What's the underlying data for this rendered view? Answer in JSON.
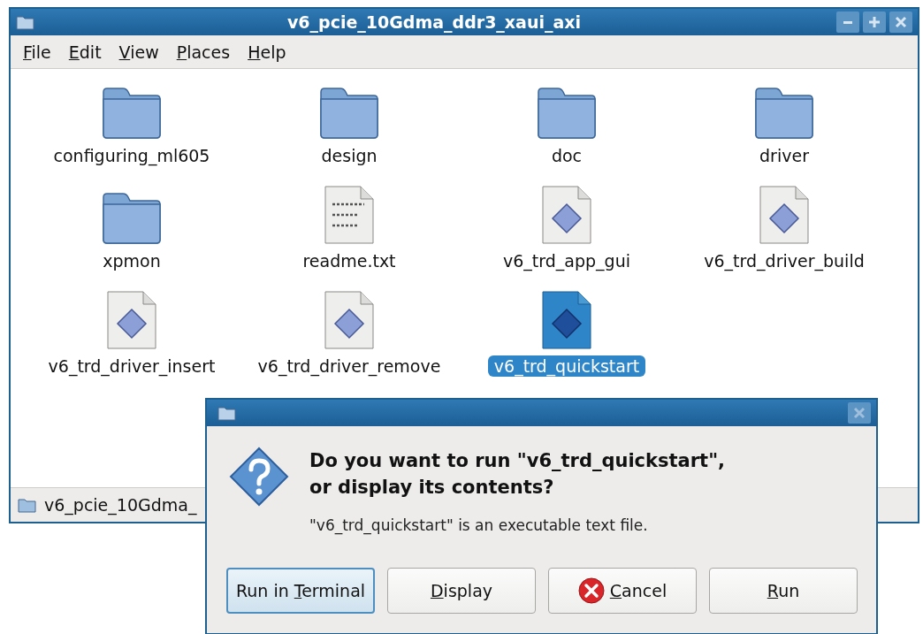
{
  "window": {
    "title": "v6_pcie_10Gdma_ddr3_xaui_axi"
  },
  "menu": [
    {
      "key": "F",
      "rest": "ile"
    },
    {
      "key": "E",
      "rest": "dit"
    },
    {
      "key": "V",
      "rest": "iew"
    },
    {
      "key": "P",
      "rest": "laces"
    },
    {
      "key": "H",
      "rest": "elp"
    }
  ],
  "files": [
    {
      "name": "configuring_ml605",
      "kind": "folder",
      "selected": false
    },
    {
      "name": "design",
      "kind": "folder",
      "selected": false
    },
    {
      "name": "doc",
      "kind": "folder",
      "selected": false
    },
    {
      "name": "driver",
      "kind": "folder",
      "selected": false
    },
    {
      "name": "xpmon",
      "kind": "folder",
      "selected": false
    },
    {
      "name": "readme.txt",
      "kind": "text",
      "selected": false
    },
    {
      "name": "v6_trd_app_gui",
      "kind": "script",
      "selected": false
    },
    {
      "name": "v6_trd_driver_build",
      "kind": "script",
      "selected": false
    },
    {
      "name": "v6_trd_driver_insert",
      "kind": "script",
      "selected": false
    },
    {
      "name": "v6_trd_driver_remove",
      "kind": "script",
      "selected": false
    },
    {
      "name": "v6_trd_quickstart",
      "kind": "script",
      "selected": true
    }
  ],
  "status_bar": {
    "text": "v6_pcie_10Gdma_"
  },
  "dialog": {
    "heading": "Do you want to run \"v6_trd_quickstart\",\nor display its contents?",
    "message": "\"v6_trd_quickstart\" is an executable text file.",
    "buttons": [
      {
        "lead": "Run in ",
        "key": "T",
        "rest": "erminal",
        "kind": "plain",
        "focused": true
      },
      {
        "key": "D",
        "rest": "isplay",
        "kind": "plain",
        "focused": false
      },
      {
        "key": "C",
        "rest": "ancel",
        "kind": "cancel",
        "focused": false
      },
      {
        "key": "R",
        "rest": "un",
        "kind": "plain",
        "focused": false
      }
    ]
  }
}
